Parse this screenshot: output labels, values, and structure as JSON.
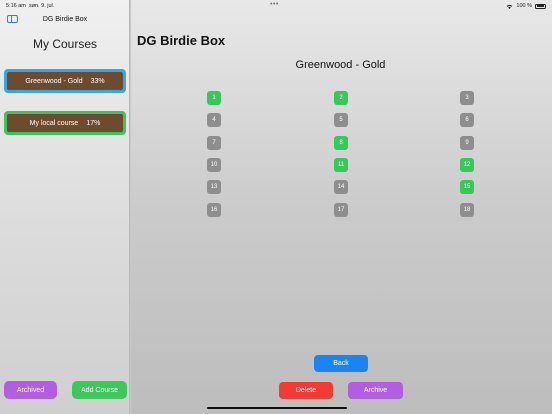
{
  "status_bar": {
    "time": "5:16 am",
    "date": "søn. 9. jul.",
    "battery": "100 %"
  },
  "sidebar": {
    "app_title": "DG Birdie Box",
    "heading": "My Courses",
    "courses": [
      {
        "name": "Greenwood - Gold",
        "progress": "33%"
      },
      {
        "name": "My local course",
        "progress": "17%"
      }
    ],
    "archived_label": "Archived",
    "add_course_label": "Add Course"
  },
  "main": {
    "title": "DG Birdie Box",
    "course_name": "Greenwood - Gold",
    "holes": [
      {
        "number": "1",
        "birdie": true
      },
      {
        "number": "2",
        "birdie": true
      },
      {
        "number": "3",
        "birdie": false
      },
      {
        "number": "4",
        "birdie": false
      },
      {
        "number": "5",
        "birdie": false
      },
      {
        "number": "6",
        "birdie": false
      },
      {
        "number": "7",
        "birdie": false
      },
      {
        "number": "8",
        "birdie": true
      },
      {
        "number": "9",
        "birdie": false
      },
      {
        "number": "10",
        "birdie": false
      },
      {
        "number": "11",
        "birdie": true
      },
      {
        "number": "12",
        "birdie": true
      },
      {
        "number": "13",
        "birdie": false
      },
      {
        "number": "14",
        "birdie": false
      },
      {
        "number": "15",
        "birdie": true
      },
      {
        "number": "16",
        "birdie": false
      },
      {
        "number": "17",
        "birdie": false
      },
      {
        "number": "18",
        "birdie": false
      }
    ],
    "back_label": "Back",
    "delete_label": "Delete",
    "archive_label": "Archive"
  },
  "colors": {
    "birdie": "#38c759",
    "not_birdie": "#8e8e8e",
    "course_card": "#6e4b2f",
    "selected_outline": "#35a8e2",
    "accent_blue": "#1a84f5",
    "delete_red": "#f33b35",
    "purple": "#b15fe0",
    "green": "#3cc85a"
  }
}
